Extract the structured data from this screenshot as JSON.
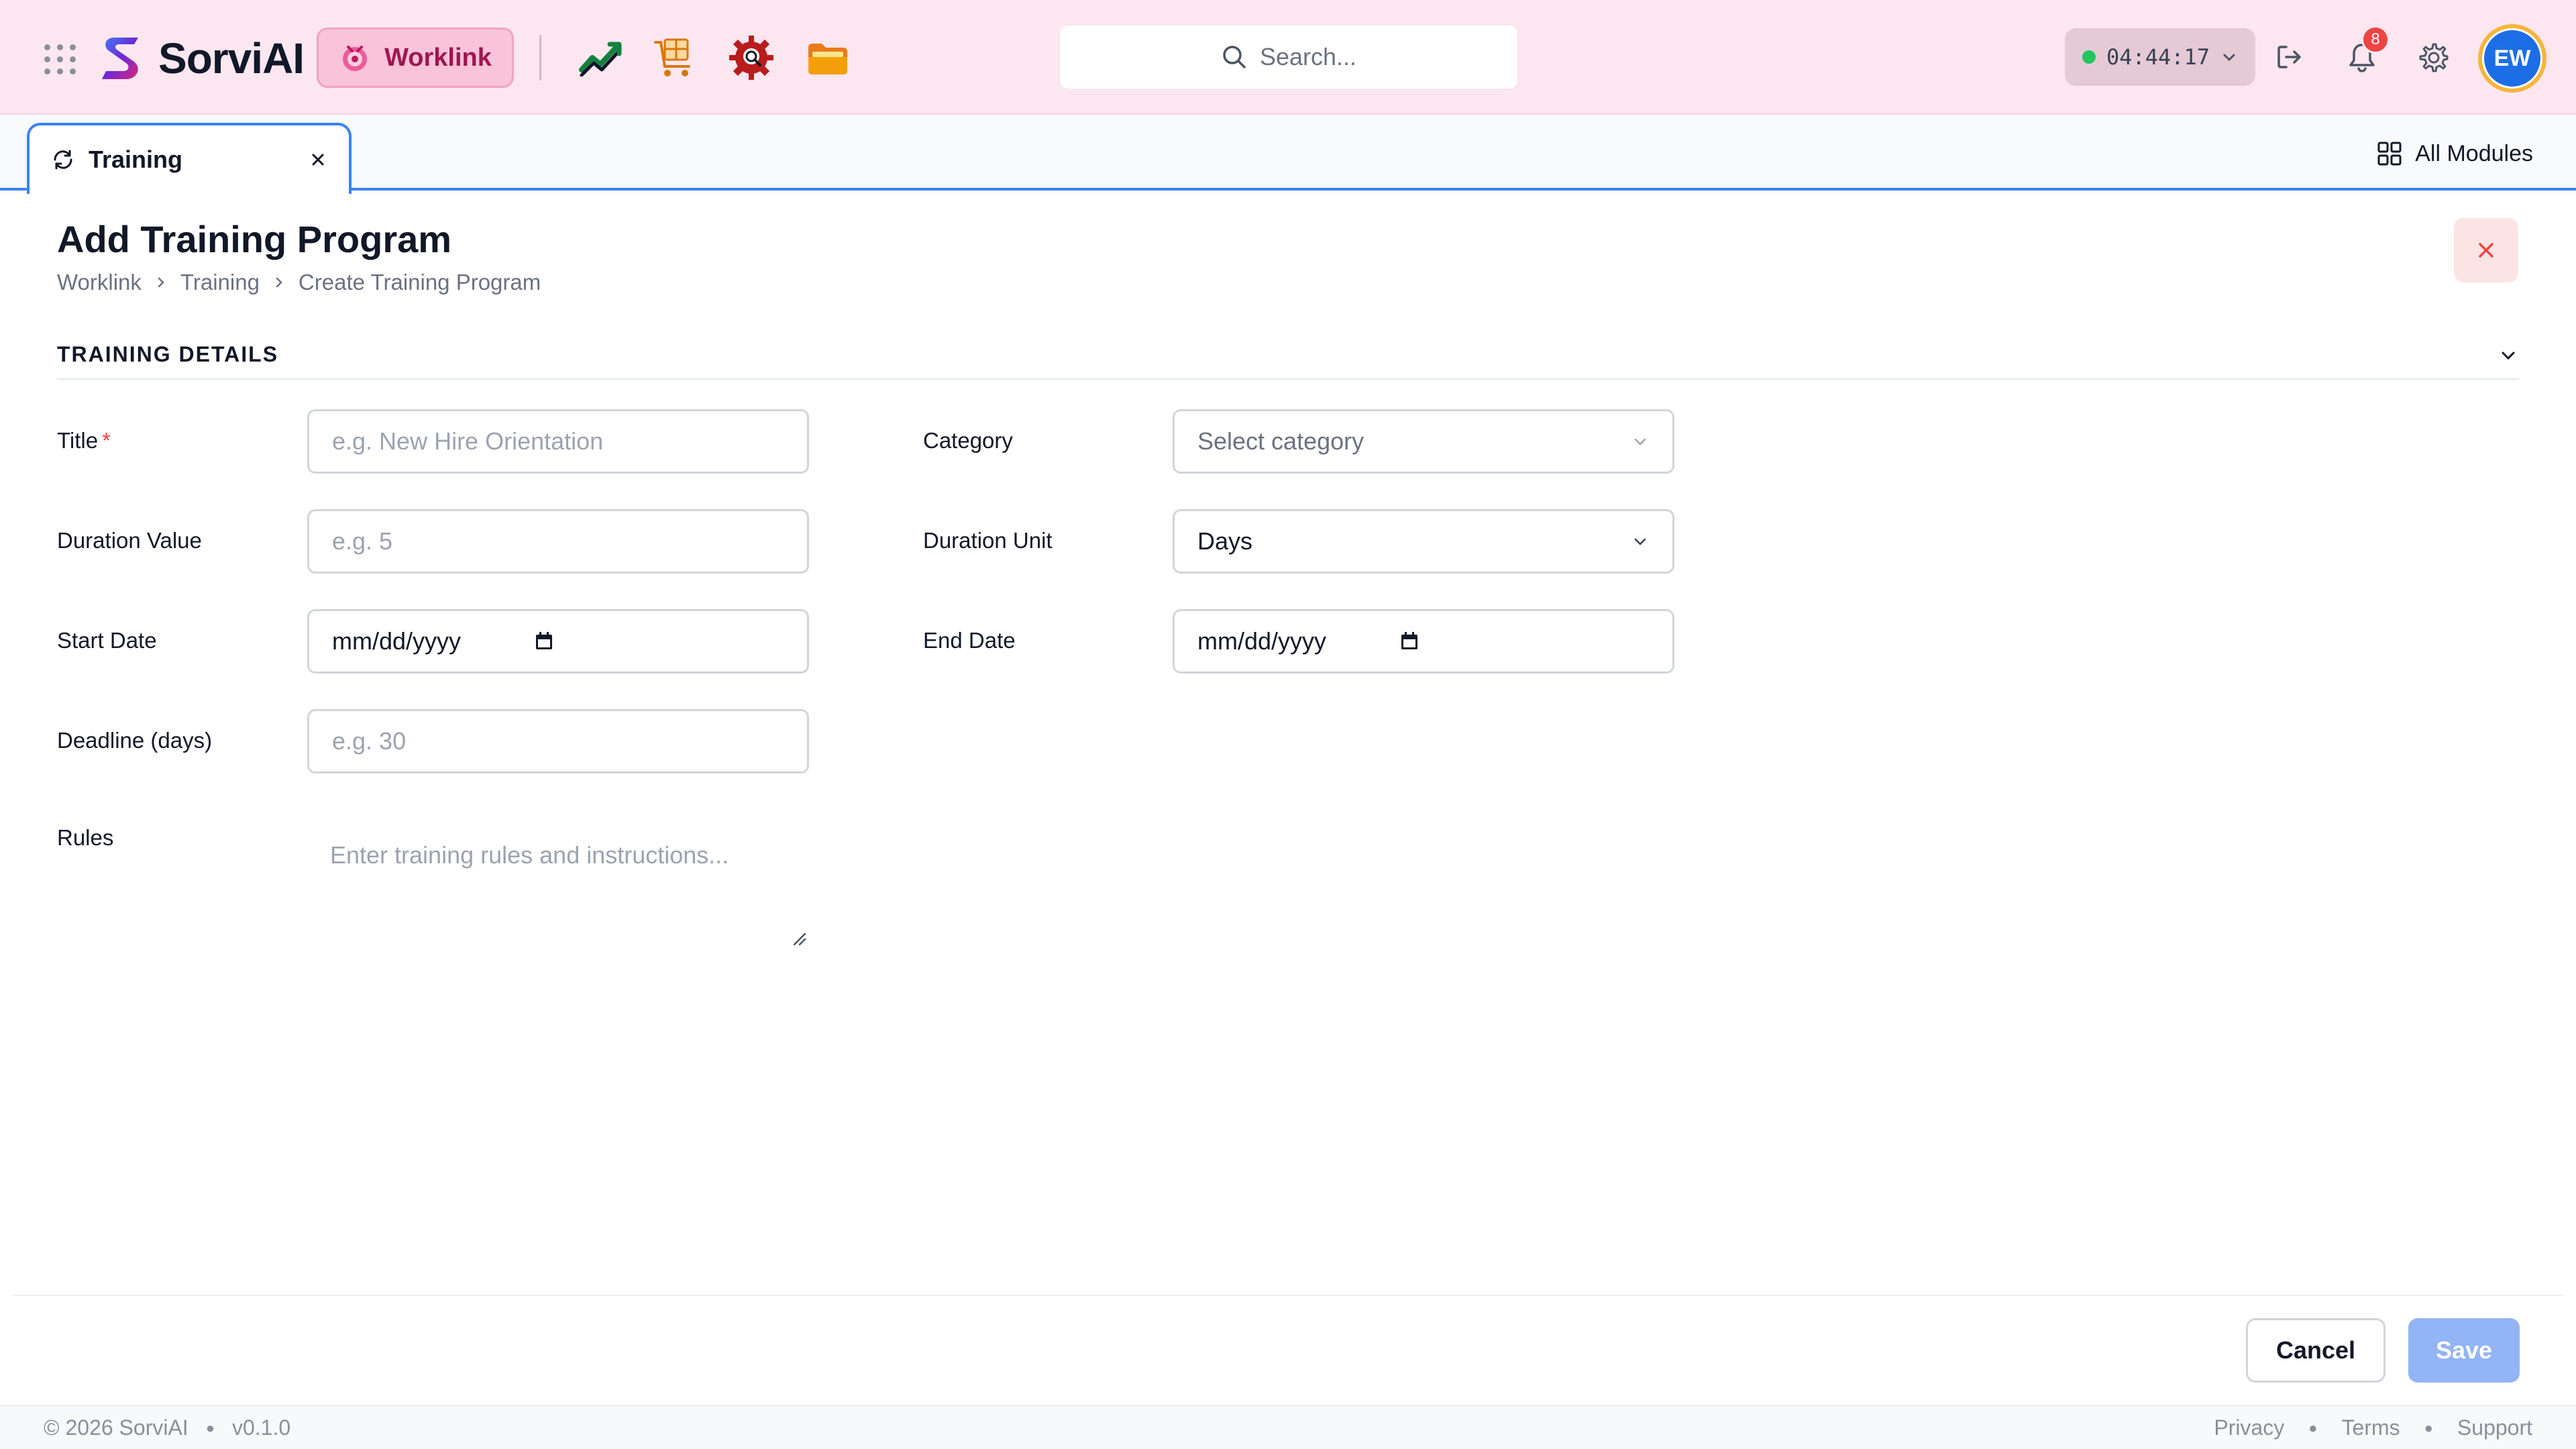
{
  "app": {
    "name": "SorviAI",
    "active_module": "Worklink",
    "search_placeholder": "Search...",
    "timer": "04:44:17",
    "notifications_count": "8",
    "user_initials": "EW",
    "icons": {
      "apps": "apps-grid-icon",
      "module_1": "analytics-trend-icon",
      "module_2": "package-cart-icon",
      "module_3": "gear-search-icon",
      "module_4": "folder-icon"
    },
    "colors": {
      "topbar": "#fce7f1",
      "accent": "#3b82f6",
      "brand_pink": "#9d174d",
      "online": "#22c55e",
      "danger": "#ef4444"
    }
  },
  "tabs": {
    "active_tab": "Training",
    "all_modules_label": "All Modules"
  },
  "page": {
    "title": "Add Training Program",
    "breadcrumb": [
      "Worklink",
      "Training",
      "Create Training Program"
    ]
  },
  "section": {
    "title": "TRAINING DETAILS"
  },
  "form": {
    "title": {
      "label": "Title",
      "required_mark": "*",
      "placeholder": "e.g. New Hire Orientation"
    },
    "category": {
      "label": "Category",
      "placeholder": "Select category"
    },
    "duration_value": {
      "label": "Duration Value",
      "placeholder": "e.g. 5"
    },
    "duration_unit": {
      "label": "Duration Unit",
      "value": "Days"
    },
    "start_date": {
      "label": "Start Date",
      "value": "mm/dd/yyyy"
    },
    "end_date": {
      "label": "End Date",
      "value": "mm/dd/yyyy"
    },
    "deadline": {
      "label": "Deadline (days)",
      "placeholder": "e.g. 30"
    },
    "rules": {
      "label": "Rules",
      "placeholder": "Enter training rules and instructions..."
    }
  },
  "actions": {
    "cancel": "Cancel",
    "save": "Save"
  },
  "footer": {
    "copyright": "© 2026 SorviAI",
    "version": "v0.1.0",
    "links": [
      "Privacy",
      "Terms",
      "Support"
    ]
  }
}
